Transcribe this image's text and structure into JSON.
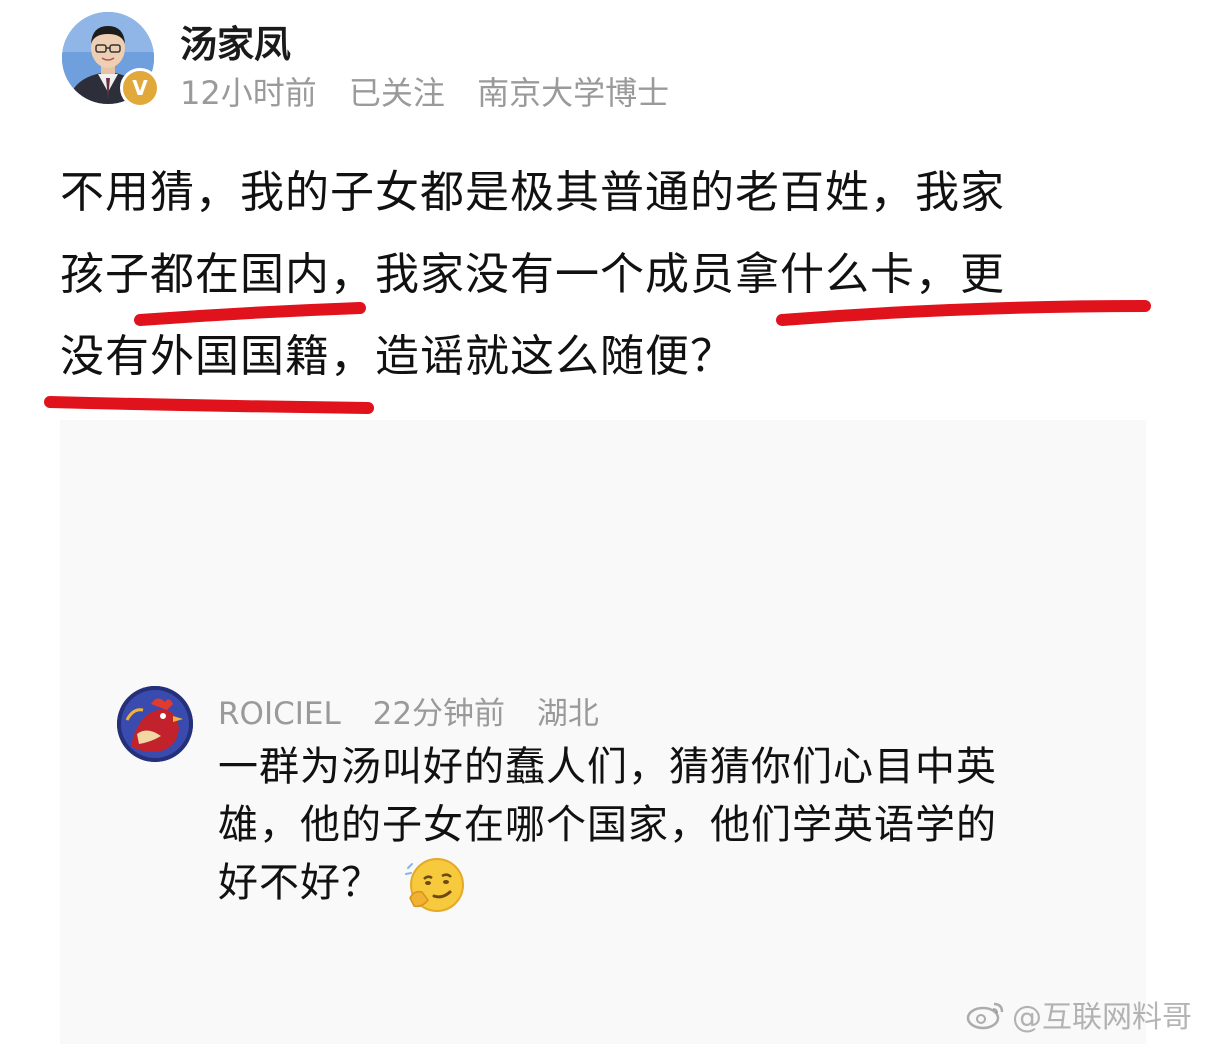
{
  "post": {
    "author": {
      "name": "汤家凤",
      "avatar_icon": "person-avatar",
      "verified_badge": "V",
      "verified_color": "#e0a93a"
    },
    "meta": {
      "time": "12小时前",
      "follow_status": "已关注",
      "bio": "南京大学博士"
    },
    "body_lines": [
      "不用猜，我的子女都是极其普通的老百姓，我家",
      "孩子都在国内，我家没有一个成员拿什么卡，更",
      "没有外国国籍，造谣就这么随便？"
    ],
    "highlight_color": "#e0121c"
  },
  "reply": {
    "user": "ROICIEL",
    "time": "22分钟前",
    "location": "湖北",
    "avatar_icon": "rooster-avatar",
    "body_lines": [
      "一群为汤叫好的蠢人们，猜猜你们心目中英",
      "雄，他的子女在哪个国家，他们学英语学的",
      "好不好？"
    ],
    "emoji_icon": "thinking-smirk-emoji"
  },
  "watermark": {
    "text": "@互联网料哥",
    "icon": "weibo-icon"
  }
}
